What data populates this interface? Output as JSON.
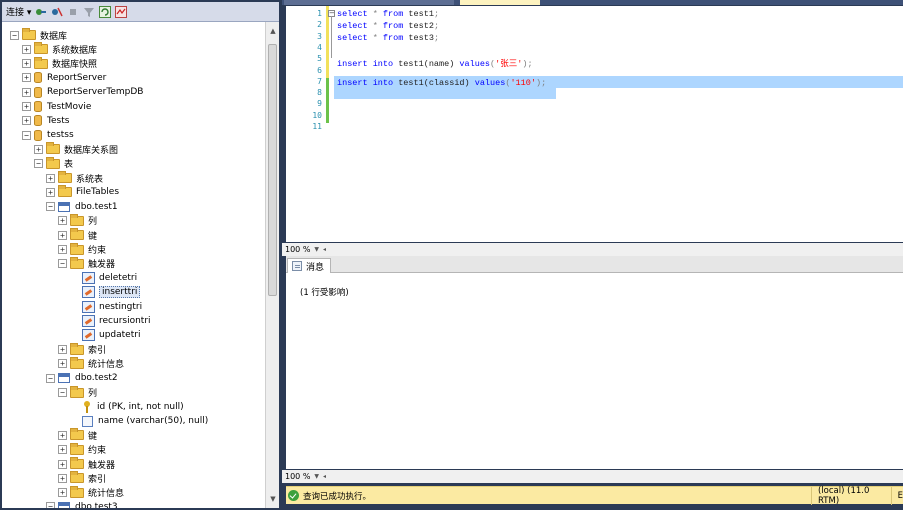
{
  "object_explorer": {
    "toolbar": {
      "connect_label": "连接 ▾"
    },
    "tree": [
      {
        "label": "数据库",
        "exp": "⊟",
        "icon": "folder"
      },
      {
        "label": "系统数据库",
        "exp": "⊞",
        "icon": "folder"
      },
      {
        "label": "数据库快照",
        "exp": "⊞",
        "icon": "folder"
      },
      {
        "label": "ReportServer",
        "exp": "⊞",
        "icon": "db"
      },
      {
        "label": "ReportServerTempDB",
        "exp": "⊞",
        "icon": "db"
      },
      {
        "label": "TestMovie",
        "exp": "⊞",
        "icon": "db"
      },
      {
        "label": "Tests",
        "exp": "⊞",
        "icon": "db"
      },
      {
        "label": "testss",
        "exp": "⊟",
        "icon": "db"
      },
      {
        "label": "数据库关系图",
        "exp": "⊞",
        "icon": "folder"
      },
      {
        "label": "表",
        "exp": "⊟",
        "icon": "folder"
      },
      {
        "label": "系统表",
        "exp": "⊞",
        "icon": "folder"
      },
      {
        "label": "FileTables",
        "exp": "⊞",
        "icon": "folder"
      },
      {
        "label": "dbo.test1",
        "exp": "⊟",
        "icon": "table"
      },
      {
        "label": "列",
        "exp": "⊞",
        "icon": "folder"
      },
      {
        "label": "键",
        "exp": "⊞",
        "icon": "folder"
      },
      {
        "label": "约束",
        "exp": "⊞",
        "icon": "folder"
      },
      {
        "label": "触发器",
        "exp": "⊟",
        "icon": "folder"
      },
      {
        "label": "deletetri",
        "exp": "",
        "icon": "trigger"
      },
      {
        "label": "inserttri",
        "exp": "",
        "icon": "trigger"
      },
      {
        "label": "nestingtri",
        "exp": "",
        "icon": "trigger"
      },
      {
        "label": "recursiontri",
        "exp": "",
        "icon": "trigger"
      },
      {
        "label": "updatetri",
        "exp": "",
        "icon": "trigger"
      },
      {
        "label": "索引",
        "exp": "⊞",
        "icon": "folder"
      },
      {
        "label": "统计信息",
        "exp": "⊞",
        "icon": "folder"
      },
      {
        "label": "dbo.test2",
        "exp": "⊟",
        "icon": "table"
      },
      {
        "label": "列",
        "exp": "⊟",
        "icon": "folder"
      },
      {
        "label": "id (PK, int, not null)",
        "exp": "",
        "icon": "key"
      },
      {
        "label": "name (varchar(50), null)",
        "exp": "",
        "icon": "column"
      },
      {
        "label": "键",
        "exp": "⊞",
        "icon": "folder"
      },
      {
        "label": "约束",
        "exp": "⊞",
        "icon": "folder"
      },
      {
        "label": "触发器",
        "exp": "⊞",
        "icon": "folder"
      },
      {
        "label": "索引",
        "exp": "⊞",
        "icon": "folder"
      },
      {
        "label": "统计信息",
        "exp": "⊞",
        "icon": "folder"
      },
      {
        "label": "dbo.test3",
        "exp": "⊟",
        "icon": "table"
      }
    ],
    "selected_item": "inserttri"
  },
  "editor": {
    "line_numbers": [
      "1",
      "2",
      "3",
      "4",
      "5",
      "6",
      "7",
      "8",
      "9",
      "10",
      "11"
    ],
    "lines": [
      {
        "kw1": "select",
        "rest": " * ",
        "kw2": "from",
        "tail": " test1",
        "semi": ";"
      },
      {
        "kw1": "select",
        "rest": " * ",
        "kw2": "from",
        "tail": " test2",
        "semi": ";"
      },
      {
        "kw1": "select",
        "rest": " * ",
        "kw2": "from",
        "tail": " test3",
        "semi": ";"
      },
      {
        "text": ""
      },
      {
        "a": "insert into",
        "b": " test1(name) ",
        "c": "values",
        "d": "(",
        "s": "'张三'",
        "e": ");"
      },
      {
        "text": ""
      },
      {
        "a": "insert into",
        "b": " test1(classid) ",
        "c": "values",
        "d": "(",
        "s": "'110'",
        "e": ");"
      }
    ],
    "zoom_top": "100 %",
    "zoom_bottom": "100 %"
  },
  "results": {
    "tab_label": "消息",
    "message": "(1 行受影响)"
  },
  "status": {
    "text": "查询已成功执行。",
    "server": "(local) (11.0 RTM)",
    "extra": "E"
  }
}
